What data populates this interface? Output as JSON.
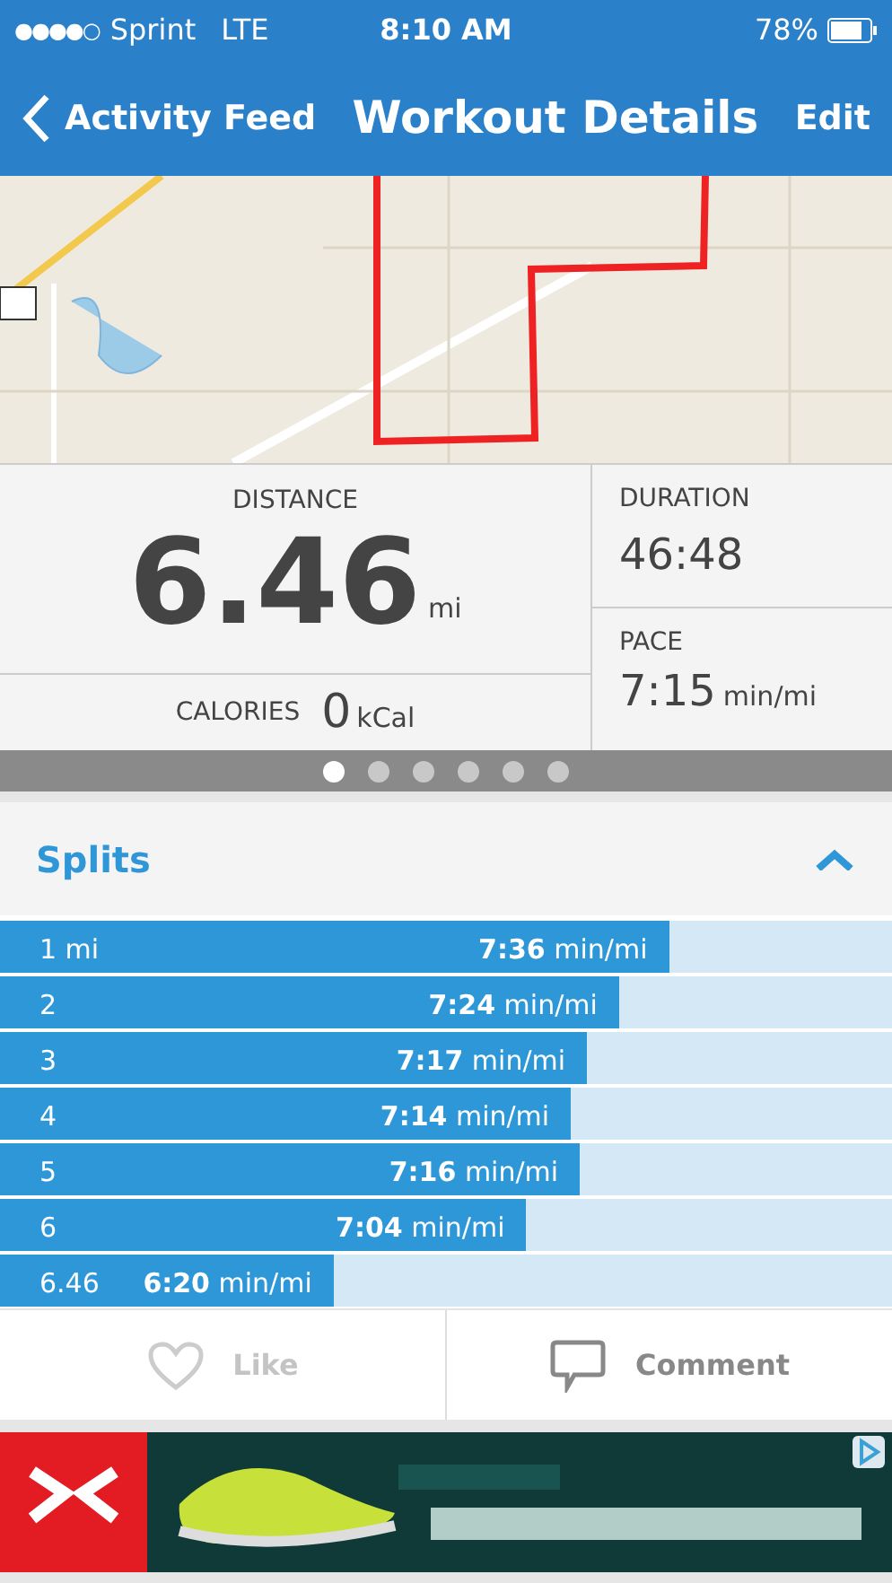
{
  "status_bar": {
    "signal": "●●●●○",
    "carrier": "Sprint",
    "network": "LTE",
    "time": "8:10 AM",
    "battery": "78%"
  },
  "nav": {
    "back": "Activity Feed",
    "title": "Workout Details",
    "action": "Edit"
  },
  "stats": {
    "distance": {
      "label": "DISTANCE",
      "value": "6.46",
      "unit": "mi"
    },
    "calories": {
      "label": "CALORIES",
      "value": "0",
      "unit": "kCal"
    },
    "duration": {
      "label": "DURATION",
      "value": "46:48"
    },
    "pace": {
      "label": "PACE",
      "value": "7:15",
      "unit": "min/mi"
    }
  },
  "pager": [
    {
      "selected": true
    },
    {
      "selected": false
    },
    {
      "selected": false
    },
    {
      "selected": false
    },
    {
      "selected": false
    },
    {
      "selected": false
    }
  ],
  "splits": {
    "title": "Splits",
    "expanded": true,
    "rows": [
      {
        "label": "1 mi",
        "pace": "**7:36** min/mi",
        "level": 0.75
      },
      {
        "label": "2",
        "pace": "**7:24** min/mi",
        "level": 0.694
      },
      {
        "label": "3",
        "pace": "**7:17** min/mi",
        "level": 0.658
      },
      {
        "label": "4",
        "pace": "**7:14** min/mi",
        "level": 0.64
      },
      {
        "label": "5",
        "pace": "**7:16** min/mi",
        "level": 0.65
      },
      {
        "label": "6",
        "pace": "**7:04** min/mi",
        "level": 0.59
      },
      {
        "label": "6.46",
        "pace": "**6:20** min/mi",
        "level": 0.374
      }
    ]
  },
  "actions": {
    "like": "Like",
    "comment": "Comment"
  }
}
